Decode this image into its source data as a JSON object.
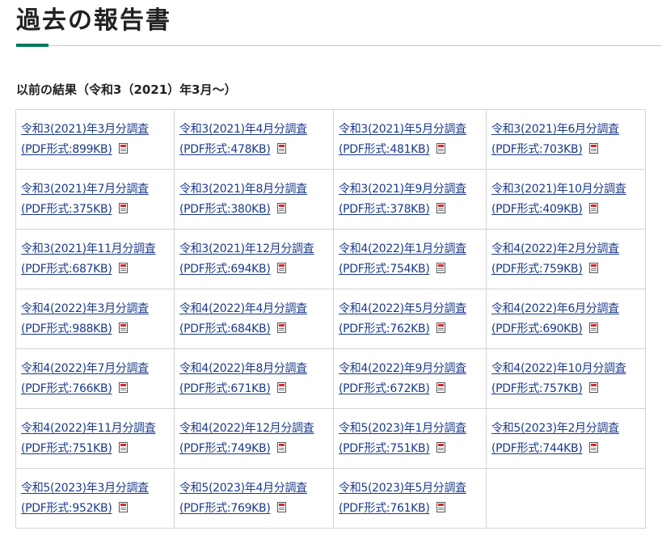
{
  "page": {
    "title": "過去の報告書",
    "section_heading": "以前の結果（令和3（2021）年3月～）"
  },
  "icons": {
    "pdf": "pdf-file-icon"
  },
  "colors": {
    "accent": "#00785a",
    "link": "#1a3a8c",
    "pdf_icon": "#d9262b"
  },
  "rows": [
    [
      {
        "title": "令和3(2021)年3月分調査",
        "meta": "(PDF形式:899KB)"
      },
      {
        "title": "令和3(2021)年4月分調査",
        "meta": "(PDF形式:478KB)"
      },
      {
        "title": "令和3(2021)年5月分調査",
        "meta": "(PDF形式:481KB)"
      },
      {
        "title": "令和3(2021)年6月分調査",
        "meta": "(PDF形式:703KB)"
      }
    ],
    [
      {
        "title": "令和3(2021)年7月分調査",
        "meta": "(PDF形式:375KB)"
      },
      {
        "title": "令和3(2021)年8月分調査",
        "meta": "(PDF形式:380KB)"
      },
      {
        "title": "令和3(2021)年9月分調査",
        "meta": "(PDF形式:378KB)"
      },
      {
        "title": "令和3(2021)年10月分調査",
        "meta": "(PDF形式:409KB)"
      }
    ],
    [
      {
        "title": "令和3(2021)年11月分調査",
        "meta": "(PDF形式:687KB)"
      },
      {
        "title": "令和3(2021)年12月分調査",
        "meta": "(PDF形式:694KB)"
      },
      {
        "title": "令和4(2022)年1月分調査",
        "meta": "(PDF形式:754KB)"
      },
      {
        "title": "令和4(2022)年2月分調査",
        "meta": "(PDF形式:759KB)"
      }
    ],
    [
      {
        "title": "令和4(2022)年3月分調査",
        "meta": "(PDF形式:988KB)"
      },
      {
        "title": "令和4(2022)年4月分調査",
        "meta": "(PDF形式:684KB)"
      },
      {
        "title": "令和4(2022)年5月分調査",
        "meta": "(PDF形式:762KB)"
      },
      {
        "title": "令和4(2022)年6月分調査",
        "meta": "(PDF形式:690KB)"
      }
    ],
    [
      {
        "title": "令和4(2022)年7月分調査",
        "meta": "(PDF形式:766KB)"
      },
      {
        "title": "令和4(2022)年8月分調査",
        "meta": "(PDF形式:671KB)"
      },
      {
        "title": "令和4(2022)年9月分調査",
        "meta": "(PDF形式:672KB)"
      },
      {
        "title": "令和4(2022)年10月分調査",
        "meta": "(PDF形式:757KB)"
      }
    ],
    [
      {
        "title": "令和4(2022)年11月分調査",
        "meta": "(PDF形式:751KB)"
      },
      {
        "title": "令和4(2022)年12月分調査",
        "meta": "(PDF形式:749KB)"
      },
      {
        "title": "令和5(2023)年1月分調査",
        "meta": "(PDF形式:751KB)"
      },
      {
        "title": "令和5(2023)年2月分調査",
        "meta": "(PDF形式:744KB)"
      }
    ],
    [
      {
        "title": "令和5(2023)年3月分調査",
        "meta": "(PDF形式:952KB)"
      },
      {
        "title": "令和5(2023)年4月分調査",
        "meta": "(PDF形式:769KB)"
      },
      {
        "title": "令和5(2023)年5月分調査",
        "meta": "(PDF形式:761KB)"
      },
      null
    ]
  ]
}
